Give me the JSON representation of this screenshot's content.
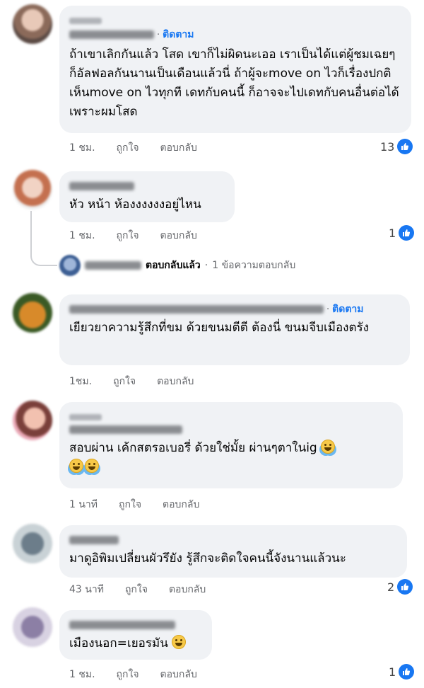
{
  "ui": {
    "dot": "·",
    "follow": "ติดตาม",
    "like": "ถูกใจ",
    "reply": "ตอบกลับ",
    "like_icon_color": "#1877f2"
  },
  "comments": [
    {
      "id": "c1",
      "text": "ถ้าเขาเลิกกันแล้ว โสด เขาก็ไม่ผิดนะเออ เราเป็นได้แต่ผู้ชมเฉยๆ ก็อัลฟอลกันนานเป็นเดือนแล้วนี่ ถ้าผู้จะmove on ไวก็เรื่องปกติ เห็นmove on ไวทุกที เดทกับคนนี้ ก็อาจจะไปเดทกับคนอื่นต่อได้ เพราะผมโสด",
      "time": "1 ชม.",
      "reactions": "13",
      "reaction_icon": "like-icon"
    },
    {
      "id": "c2",
      "text": "หัว หน้า ห้องงงงงงอยู่ไหน",
      "time": "1 ชม.",
      "reactions": "1",
      "reaction_icon": "like-icon",
      "reply_summary": {
        "action": "ตอบกลับแล้ว",
        "count": "1 ข้อความตอบกลับ"
      }
    },
    {
      "id": "c3",
      "text": "เยียวยาความรู้สึกที่ขม ด้วยขนมตีตี ต้องนี่ ขนมจีบเมืองตรัง",
      "time": "1ชม."
    },
    {
      "id": "c4",
      "text": "สอบผ่าน เค้กสตรอเบอรี่ ด้วยใช่มั้ย ผ่านๆตาในig",
      "emoji": "laughing-tears-emoji",
      "time": "1 นาที"
    },
    {
      "id": "c5",
      "text": "มาดูอิพิมเปลี่ยนผัวรึยัง รู้สึกจะติดใจคนนี้จังนานแล้วนะ",
      "time": "43 นาที",
      "reactions": "2",
      "reaction_icon": "like-icon"
    },
    {
      "id": "c6",
      "text": "เมืองนอก=เยอรมัน",
      "emoji": "grinning-sweat-emoji",
      "time": "1 ชม.",
      "reactions": "1",
      "reaction_icon": "like-icon"
    }
  ]
}
